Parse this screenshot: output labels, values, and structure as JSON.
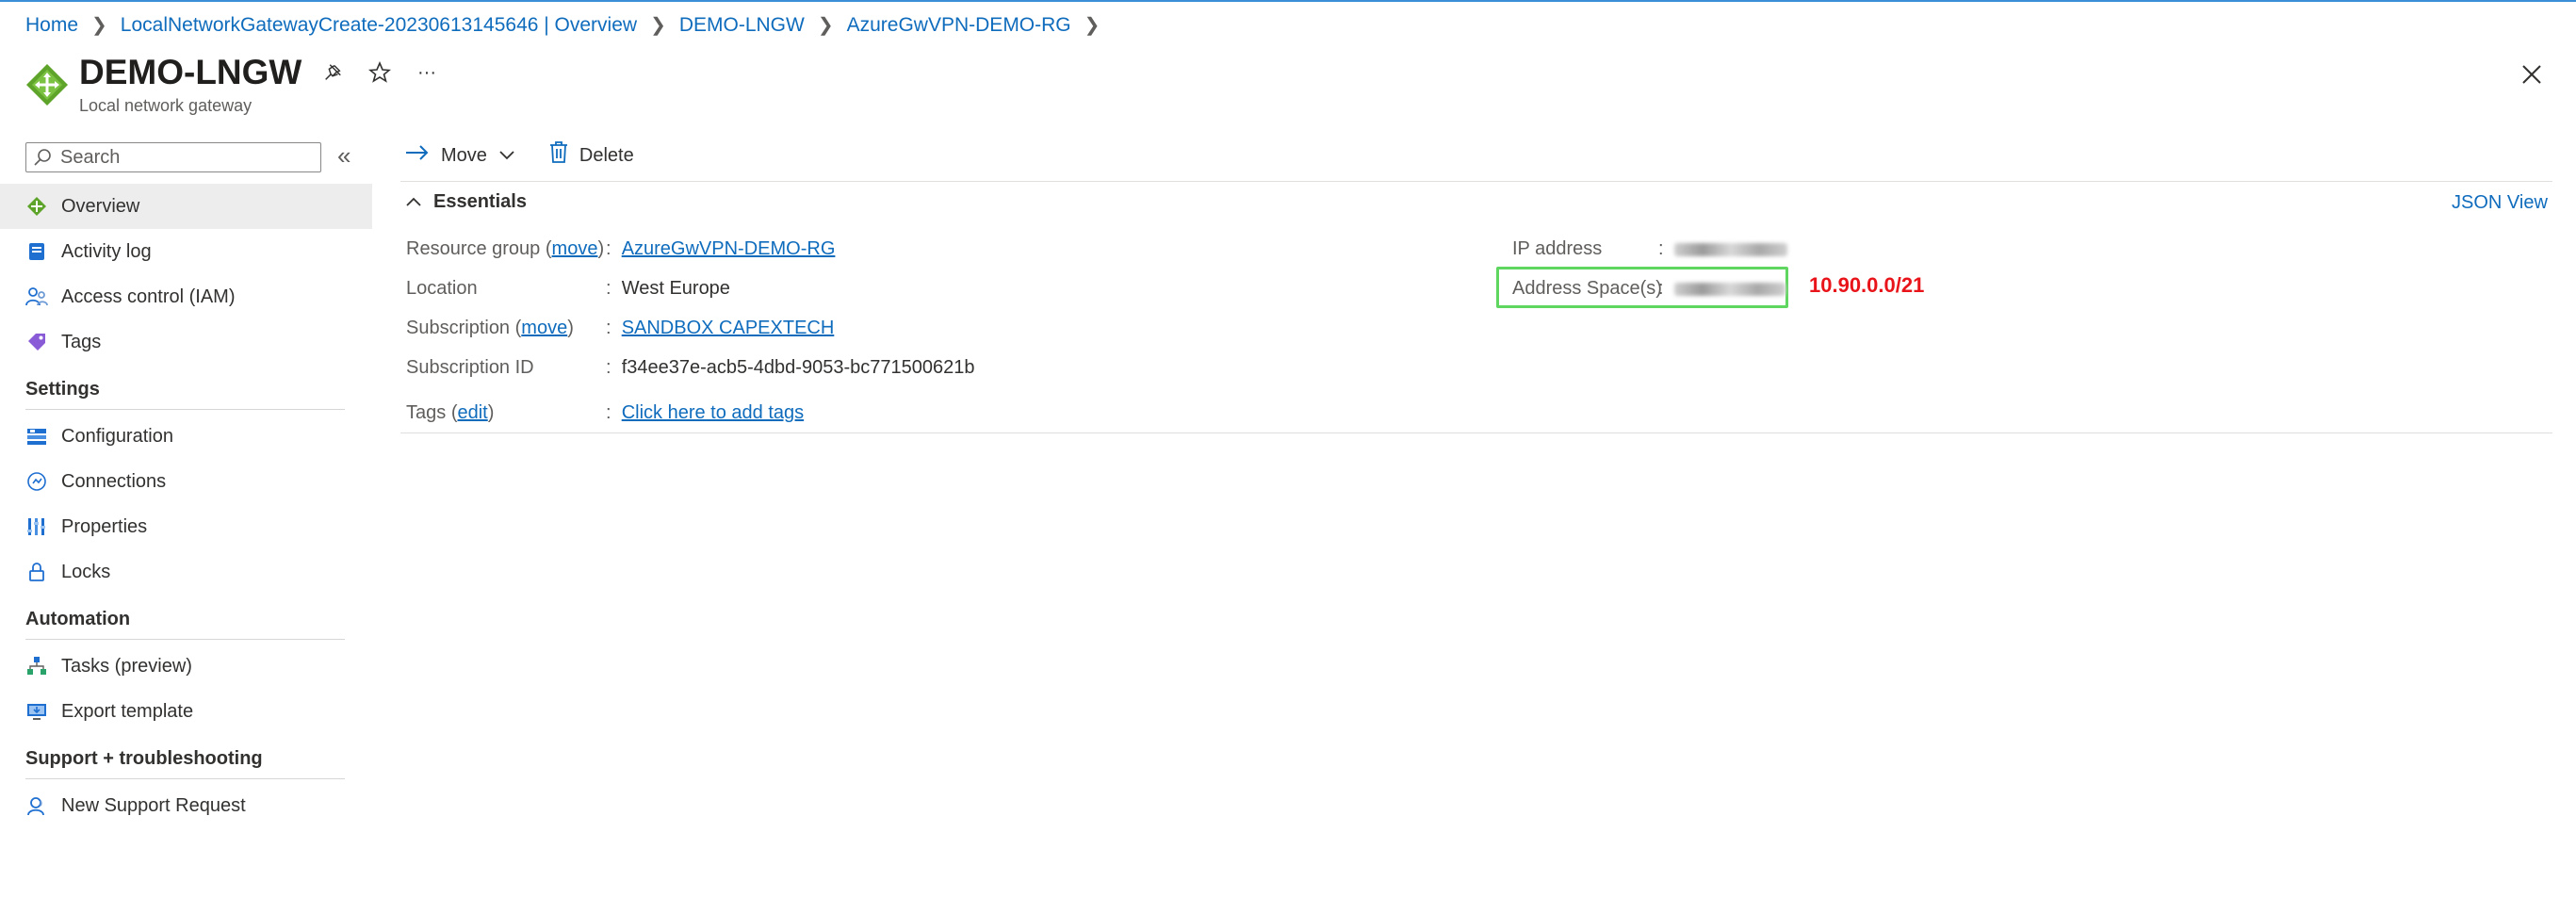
{
  "breadcrumb": [
    {
      "label": "Home"
    },
    {
      "label": "LocalNetworkGatewayCreate-20230613145646 | Overview"
    },
    {
      "label": "DEMO-LNGW"
    },
    {
      "label": "AzureGwVPN-DEMO-RG"
    }
  ],
  "header": {
    "title": "DEMO-LNGW",
    "subtitle": "Local network gateway",
    "more_label": "···"
  },
  "search": {
    "placeholder": "Search"
  },
  "sidebar": {
    "collapse_label": "«",
    "items": [
      {
        "label": "Overview",
        "icon": "gateway-icon"
      },
      {
        "label": "Activity log",
        "icon": "activity-log-icon"
      },
      {
        "label": "Access control (IAM)",
        "icon": "iam-icon"
      },
      {
        "label": "Tags",
        "icon": "tag-icon"
      }
    ],
    "sections": [
      {
        "title": "Settings",
        "items": [
          {
            "label": "Configuration"
          },
          {
            "label": "Connections"
          },
          {
            "label": "Properties"
          },
          {
            "label": "Locks"
          }
        ]
      },
      {
        "title": "Automation",
        "items": [
          {
            "label": "Tasks (preview)"
          },
          {
            "label": "Export template"
          }
        ]
      },
      {
        "title": "Support + troubleshooting",
        "items": [
          {
            "label": "New Support Request"
          }
        ]
      }
    ]
  },
  "toolbar": {
    "move_label": "Move",
    "delete_label": "Delete"
  },
  "essentials": {
    "title": "Essentials",
    "json_view_label": "JSON View",
    "left": {
      "resource_group": {
        "label": "Resource group",
        "action": "move",
        "value": "AzureGwVPN-DEMO-RG"
      },
      "location": {
        "label": "Location",
        "value": "West Europe"
      },
      "subscription": {
        "label": "Subscription",
        "action": "move",
        "value": "SANDBOX CAPEXTECH"
      },
      "subscription_id": {
        "label": "Subscription ID",
        "value": "f34ee37e-acb5-4dbd-9053-bc771500621b"
      },
      "tags": {
        "label": "Tags",
        "action": "edit",
        "value": "Click here to add tags"
      }
    },
    "right": {
      "ip_address": {
        "label": "IP address"
      },
      "address_space": {
        "label": "Address Space(s)"
      }
    },
    "colon": ":"
  },
  "annotation": {
    "text": "10.90.0.0/21",
    "color": "#e8141a"
  },
  "colors": {
    "accent": "#0f6cbd",
    "highlight_border": "#5fd65f"
  }
}
